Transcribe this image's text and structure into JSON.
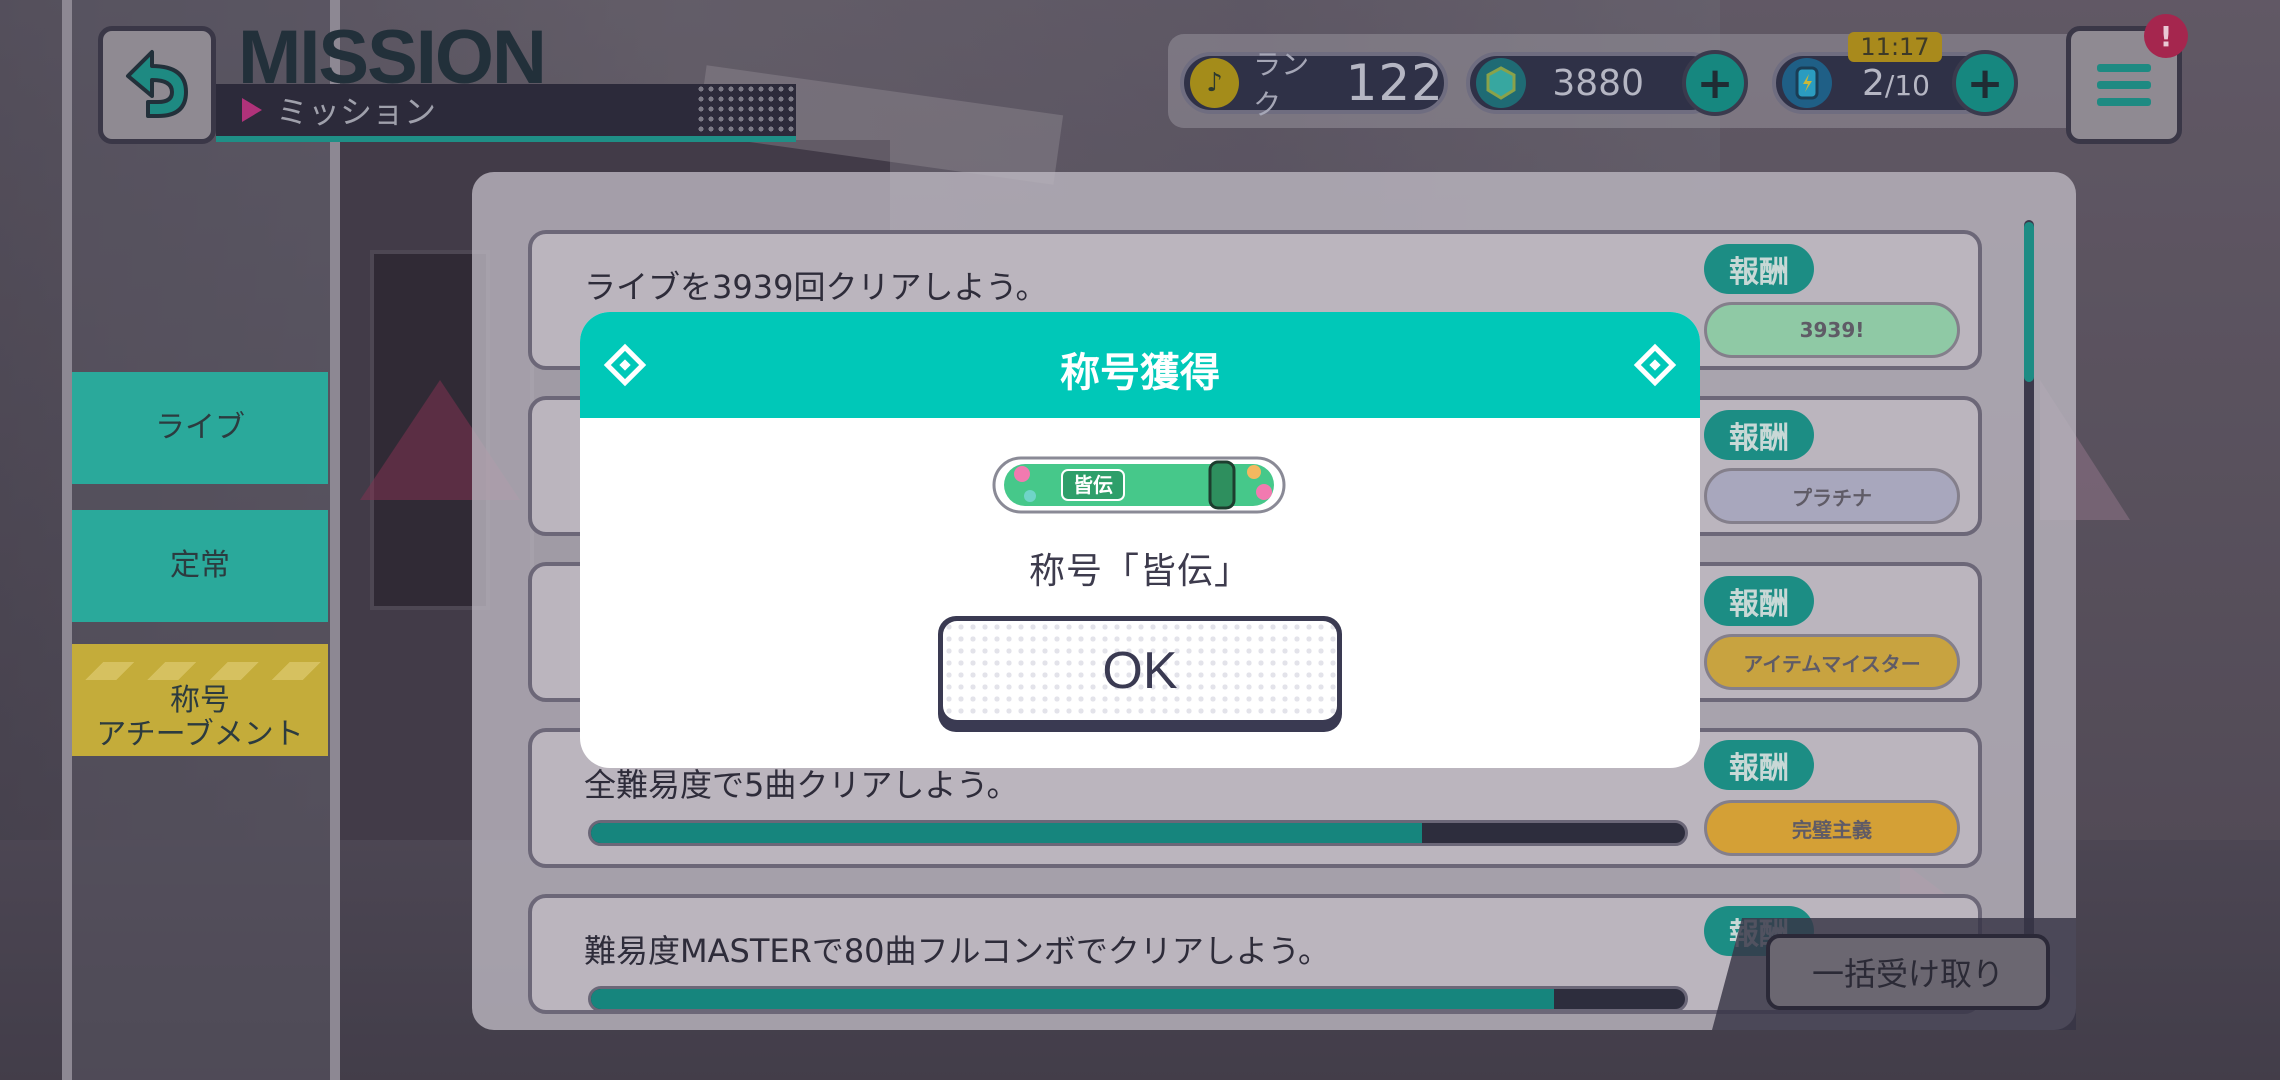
{
  "header": {
    "title": "MISSION",
    "subtitle": "ミッション",
    "rank_label": "ランク",
    "rank_value": "122",
    "gems": "3880",
    "energy_current": "2",
    "energy_max": "/10",
    "energy_timer": "11:17",
    "alert_badge": "!"
  },
  "sidebar": {
    "items": [
      {
        "label": "ライブ"
      },
      {
        "label": "定常"
      },
      {
        "label": "称号\nアチーブメント"
      }
    ]
  },
  "missions": [
    {
      "text": "ライブを3939回クリアしよう。",
      "reward_label": "報酬",
      "reward_text": "3939!",
      "reward_color": "#8fc9a5"
    },
    {
      "text": "",
      "reward_label": "報酬",
      "reward_text": "プラチナ",
      "reward_color": "#a8a7bd"
    },
    {
      "text": "",
      "reward_label": "報酬",
      "reward_text": "アイテムマイスター",
      "reward_color": "#c8a340"
    },
    {
      "text": "全難易度で5曲クリアしよう。",
      "reward_label": "報酬",
      "reward_text": "完璧主義",
      "reward_color": "#d4a036",
      "progress": 0.76
    },
    {
      "text": "難易度MASTERで80曲フルコンボでクリアしよう。",
      "reward_label": "報酬",
      "reward_text": "",
      "reward_color": "#8fc9a5",
      "progress": 0.88
    }
  ],
  "claim_all_label": "一括受け取り",
  "modal": {
    "title": "称号獲得",
    "badge_text": "皆伝",
    "title_name": "称号「皆伝」",
    "ok_label": "OK"
  },
  "colors": {
    "accent": "#00c8b8",
    "dark": "#2f3147",
    "sidebar_tab": "#2aa99b",
    "sidebar_tab_active": "#c4ac3a"
  }
}
